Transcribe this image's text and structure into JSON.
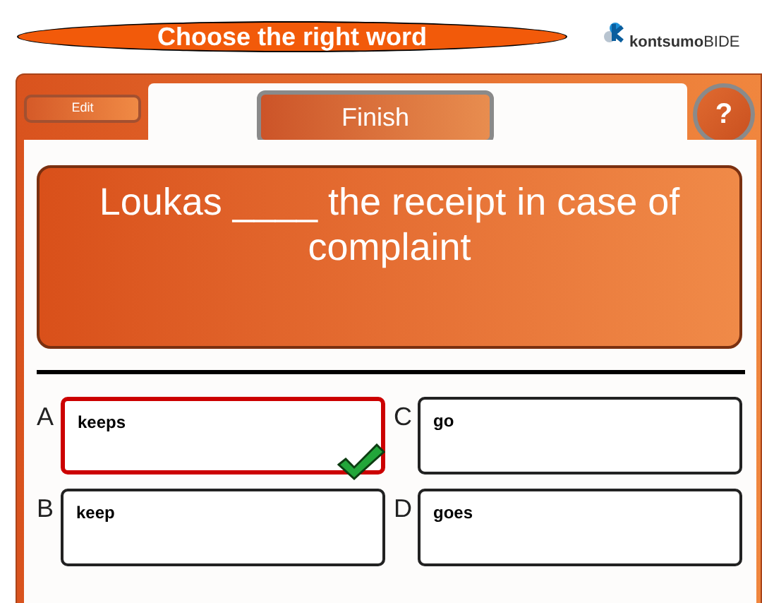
{
  "header": {
    "title": "Choose the right word",
    "logo_text": "**kontsumo**BIDE"
  },
  "toolbar": {
    "edit": "Edit",
    "finish": "Finish",
    "help": "?"
  },
  "question": "Loukas ____ the receipt in case of complaint",
  "options": [
    {
      "letter": "A",
      "text": "keeps",
      "selected": true,
      "correct": true
    },
    {
      "letter": "C",
      "text": "go",
      "selected": false,
      "correct": false
    },
    {
      "letter": "B",
      "text": "keep",
      "selected": false,
      "correct": false
    },
    {
      "letter": "D",
      "text": "goes",
      "selected": false,
      "correct": false
    }
  ]
}
